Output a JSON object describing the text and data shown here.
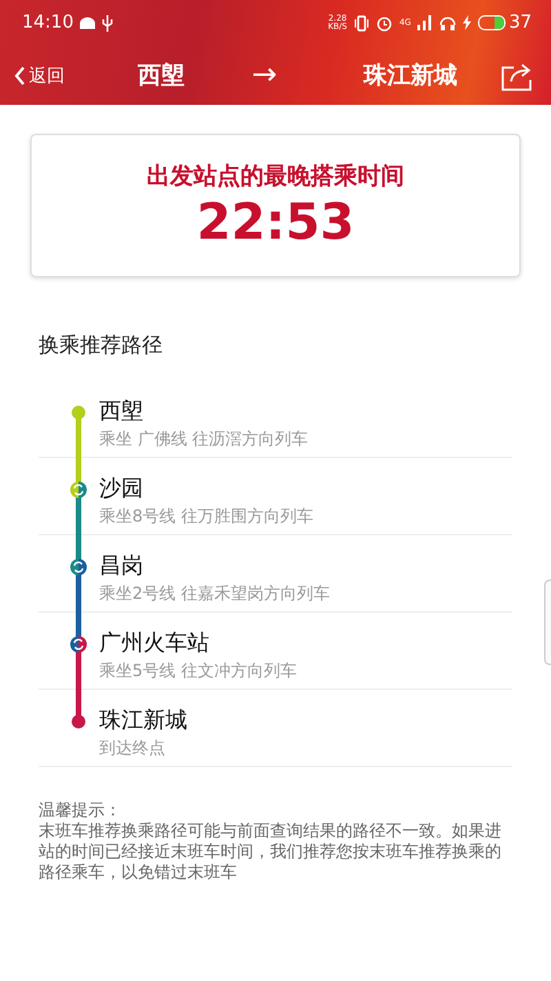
{
  "status_bar": {
    "time": "14:10",
    "speed_value": "2.28",
    "speed_unit": "KB/S",
    "network": "4G",
    "battery": "37"
  },
  "nav": {
    "back": "返回",
    "from": "西塱",
    "arrow": "→",
    "to": "珠江新城"
  },
  "last_train": {
    "title": "出发站点的最晚搭乘时间",
    "time": "22:53"
  },
  "section_title": "换乘推荐路径",
  "stations": [
    {
      "kind": "start",
      "name": "西塱",
      "detail": "乘坐 广佛线 往沥滘方向列车",
      "color": "#b5cf1a"
    },
    {
      "kind": "transfer",
      "name": "沙园",
      "detail": "乘坐8号线 往万胜围方向列车",
      "color": "#1c8a8a"
    },
    {
      "kind": "transfer",
      "name": "昌岗",
      "detail": "乘坐2号线 往嘉禾望岗方向列车",
      "color": "#1b5f9e"
    },
    {
      "kind": "transfer",
      "name": "广州火车站",
      "detail": "乘坐5号线 往文冲方向列车",
      "color": "#c8174a"
    },
    {
      "kind": "end",
      "name": "珠江新城",
      "detail": "到达终点"
    }
  ],
  "note": {
    "title": "温馨提示：",
    "text": "末班车推荐换乘路径可能与前面查询结果的路径不一致。如果进站的时间已经接近末班车时间，我们推荐您按末班车推荐换乘的路径乘车，以免错过末班车"
  }
}
